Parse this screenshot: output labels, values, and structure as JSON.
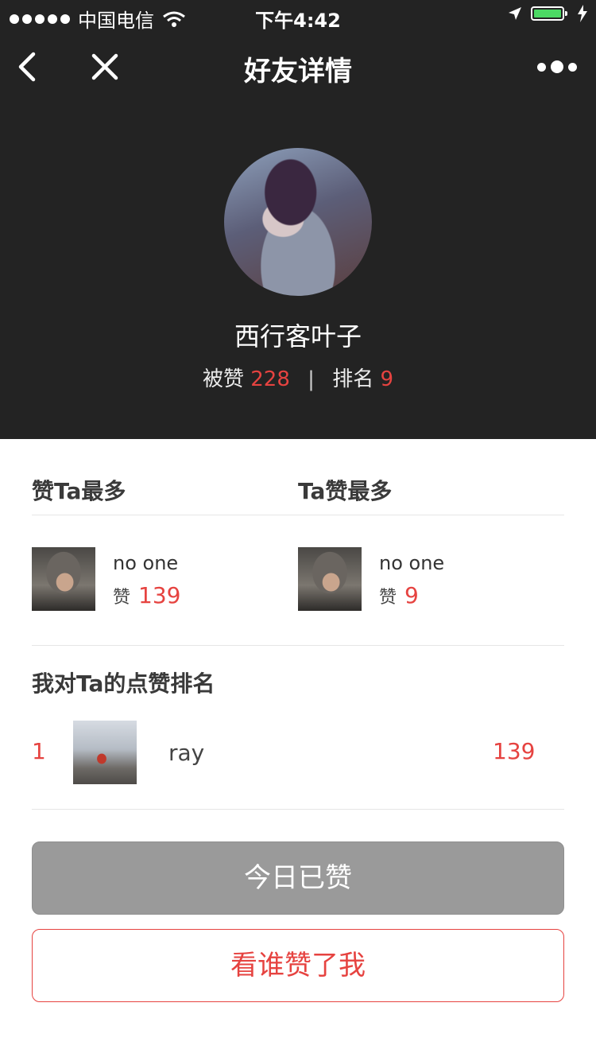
{
  "status_bar": {
    "carrier": "中国电信",
    "time": "下午4:42"
  },
  "nav": {
    "title": "好友详情"
  },
  "profile": {
    "name": "西行客叶子",
    "liked_label": "被赞",
    "liked_count": "228",
    "separator": "|",
    "rank_label": "排名",
    "rank_value": "9"
  },
  "most": {
    "left_header": "赞Ta最多",
    "right_header": "Ta赞最多",
    "left": {
      "name": "no one",
      "zan_label": "赞",
      "count": "139"
    },
    "right": {
      "name": "no one",
      "zan_label": "赞",
      "count": "9"
    }
  },
  "my_ranking": {
    "header": "我对Ta的点赞排名",
    "rows": [
      {
        "rank": "1",
        "name": "ray",
        "count": "139"
      }
    ]
  },
  "buttons": {
    "liked_today": "今日已赞",
    "who_liked_me": "看谁赞了我"
  },
  "colors": {
    "header_bg": "#232323",
    "accent_red": "#e64340",
    "button_gray": "#9a9a9a"
  }
}
